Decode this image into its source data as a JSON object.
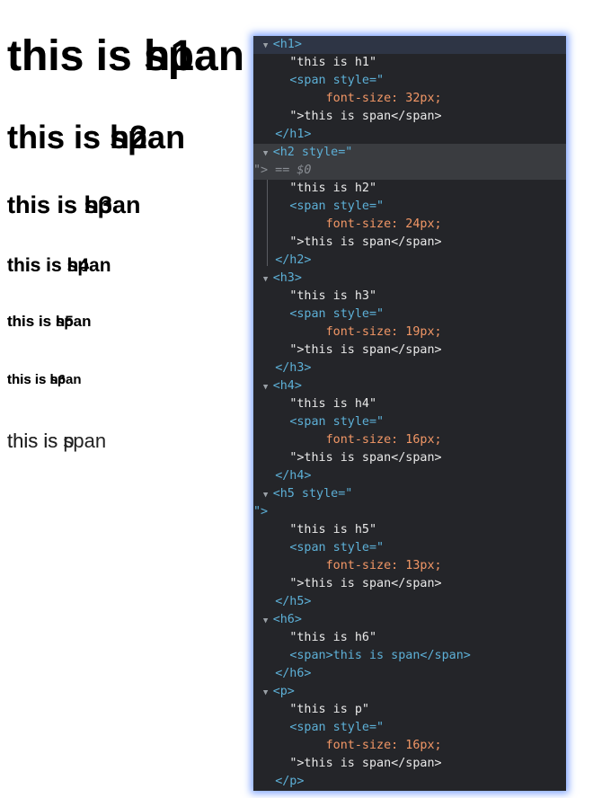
{
  "preview": {
    "h1": {
      "text": "this is h1",
      "span": "this is span"
    },
    "h2": {
      "text": "this is h2",
      "span": "this is span"
    },
    "h3": {
      "text": "this is h3",
      "span": "this is span"
    },
    "h4": {
      "text": "this is h4",
      "span": "this is span"
    },
    "h5": {
      "text": "this is h5",
      "span": "this is span"
    },
    "h6": {
      "text": "this is h6",
      "span": "this is span"
    },
    "p": {
      "text": "this is p",
      "span": "this is span"
    }
  },
  "devtools": {
    "lines": [
      "<h1>",
      "\"this is h1\"",
      "<span style=\"",
      "font-size: 32px;",
      "\">this is span</span>",
      "</h1>",
      "<h2 style=\"",
      "\"> == $0",
      "\"this is h2\"",
      "<span style=\"",
      "font-size: 24px;",
      "\">this is span</span>",
      "</h2>",
      "<h3>",
      "\"this is h3\"",
      "<span style=\"",
      "font-size: 19px;",
      "\">this is span</span>",
      "</h3>",
      "<h4>",
      "\"this is h4\"",
      "<span style=\"",
      "font-size: 16px;",
      "\">this is span</span>",
      "</h4>",
      "<h5 style=\"",
      "\">",
      "\"this is h5\"",
      "<span style=\"",
      "font-size: 13px;",
      "\">this is span</span>",
      "</h5>",
      "<h6>",
      "\"this is h6\"",
      "<span>this is span</span>",
      "</h6>",
      "<p>",
      "\"this is p\"",
      "<span style=\"",
      "font-size: 16px;",
      "\">this is span</span>",
      "</p>"
    ],
    "colors": {
      "background": "#242529",
      "tag": "#5db0d7",
      "attr": "#9bbbdc",
      "css": "#f29766",
      "selection": "#3a3c40"
    }
  }
}
